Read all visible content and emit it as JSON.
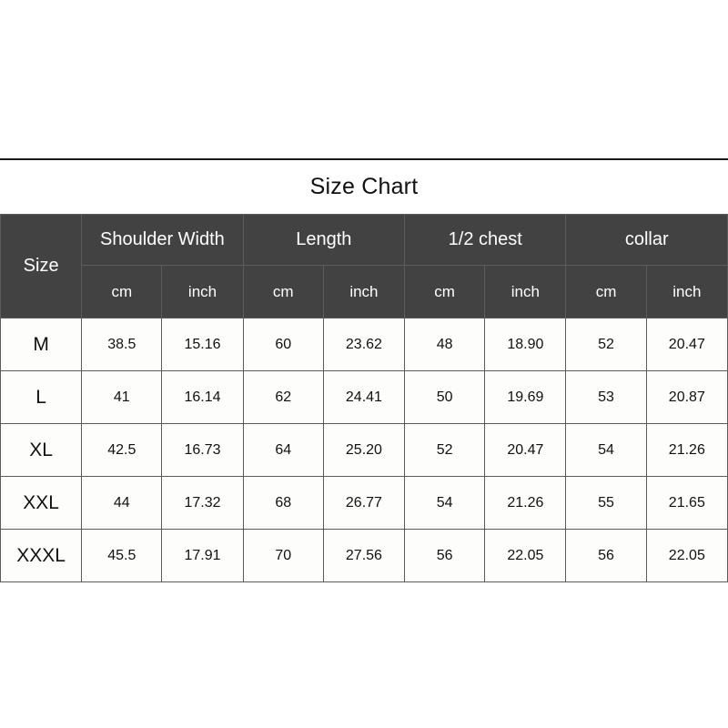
{
  "title": "Size Chart",
  "colors": {
    "header_background": "#424242",
    "header_text": "#ffffff",
    "cell_background": "#fdfdfc",
    "cell_text": "#111111",
    "grid_line": "#8e8e8e",
    "page_background": "#ffffff"
  },
  "table": {
    "size_column_header": "Size",
    "groups": [
      {
        "label": "Shoulder Width",
        "units": [
          "cm",
          "inch"
        ]
      },
      {
        "label": "Length",
        "units": [
          "cm",
          "inch"
        ]
      },
      {
        "label": "1/2 chest",
        "units": [
          "cm",
          "inch"
        ]
      },
      {
        "label": "collar",
        "units": [
          "cm",
          "inch"
        ]
      }
    ],
    "rows": [
      {
        "size": "M",
        "shoulder_cm": "38.5",
        "shoulder_inch": "15.16",
        "length_cm": "60",
        "length_inch": "23.62",
        "chest_cm": "48",
        "chest_inch": "18.90",
        "collar_cm": "52",
        "collar_inch": "20.47"
      },
      {
        "size": "L",
        "shoulder_cm": "41",
        "shoulder_inch": "16.14",
        "length_cm": "62",
        "length_inch": "24.41",
        "chest_cm": "50",
        "chest_inch": "19.69",
        "collar_cm": "53",
        "collar_inch": "20.87"
      },
      {
        "size": "XL",
        "shoulder_cm": "42.5",
        "shoulder_inch": "16.73",
        "length_cm": "64",
        "length_inch": "25.20",
        "chest_cm": "52",
        "chest_inch": "20.47",
        "collar_cm": "54",
        "collar_inch": "21.26"
      },
      {
        "size": "XXL",
        "shoulder_cm": "44",
        "shoulder_inch": "17.32",
        "length_cm": "68",
        "length_inch": "26.77",
        "chest_cm": "54",
        "chest_inch": "21.26",
        "collar_cm": "55",
        "collar_inch": "21.65"
      },
      {
        "size": "XXXL",
        "shoulder_cm": "45.5",
        "shoulder_inch": "17.91",
        "length_cm": "70",
        "length_inch": "27.56",
        "chest_cm": "56",
        "chest_inch": "22.05",
        "collar_cm": "56",
        "collar_inch": "22.05"
      }
    ]
  },
  "chart_data": {
    "type": "table",
    "title": "Size Chart",
    "columns": [
      "Size",
      "Shoulder Width cm",
      "Shoulder Width inch",
      "Length cm",
      "Length inch",
      "1/2 chest cm",
      "1/2 chest inch",
      "collar cm",
      "collar inch"
    ],
    "rows": [
      [
        "M",
        "38.5",
        "15.16",
        "60",
        "23.62",
        "48",
        "18.90",
        "52",
        "20.47"
      ],
      [
        "L",
        "41",
        "16.14",
        "62",
        "24.41",
        "50",
        "19.69",
        "53",
        "20.87"
      ],
      [
        "XL",
        "42.5",
        "16.73",
        "64",
        "25.20",
        "52",
        "20.47",
        "54",
        "21.26"
      ],
      [
        "XXL",
        "44",
        "17.32",
        "68",
        "26.77",
        "54",
        "21.26",
        "55",
        "21.65"
      ],
      [
        "XXXL",
        "45.5",
        "17.91",
        "70",
        "27.56",
        "56",
        "22.05",
        "56",
        "22.05"
      ]
    ]
  }
}
